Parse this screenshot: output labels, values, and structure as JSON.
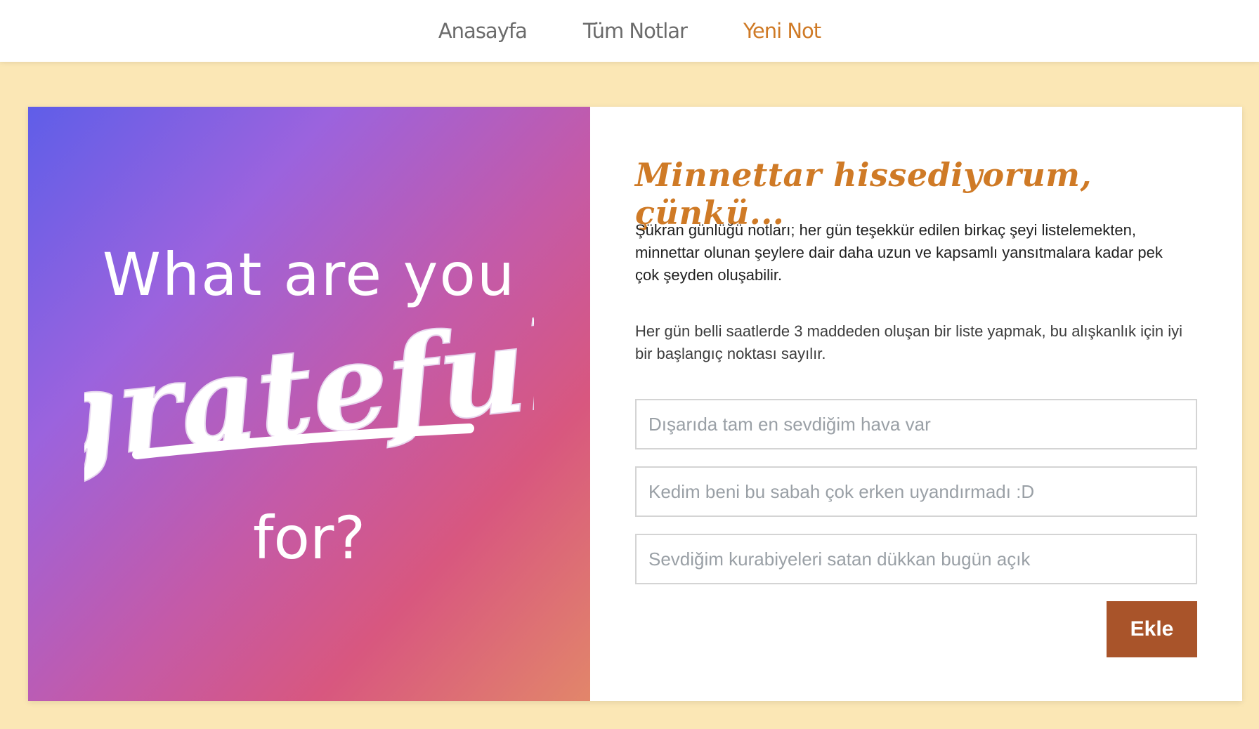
{
  "nav": {
    "items": [
      {
        "label": "Anasayfa"
      },
      {
        "label": "Tüm Notlar"
      },
      {
        "label": "Yeni Not"
      }
    ],
    "active_color": "#cf7a26"
  },
  "hero": {
    "line1": "What are you",
    "script_word": "grateful",
    "line3": "for?"
  },
  "form": {
    "heading": "Minnettar hissediyorum, çünkü...",
    "description": "Şükran günlüğü notları; her gün teşekkür edilen birkaç şeyi listelemekten, minnettar olunan şeylere dair daha uzun ve kapsamlı yansıtmalara kadar pek çok şeyden oluşabilir.",
    "tip": "Her gün belli saatlerde 3 maddeden oluşan bir liste yapmak, bu alışkanlık için iyi bir başlangıç noktası sayılır.",
    "inputs": [
      {
        "placeholder": "Dışarıda tam en sevdiğim hava var",
        "value": ""
      },
      {
        "placeholder": "Kedim beni bu sabah çok erken uyandırmadı :D",
        "value": ""
      },
      {
        "placeholder": "Sevdiğim kurabiyeleri satan dükkan bugün açık",
        "value": ""
      }
    ],
    "submit_label": "Ekle"
  },
  "colors": {
    "page_background": "#fbe7b5",
    "accent": "#cf7a26",
    "button": "#a9542a"
  }
}
